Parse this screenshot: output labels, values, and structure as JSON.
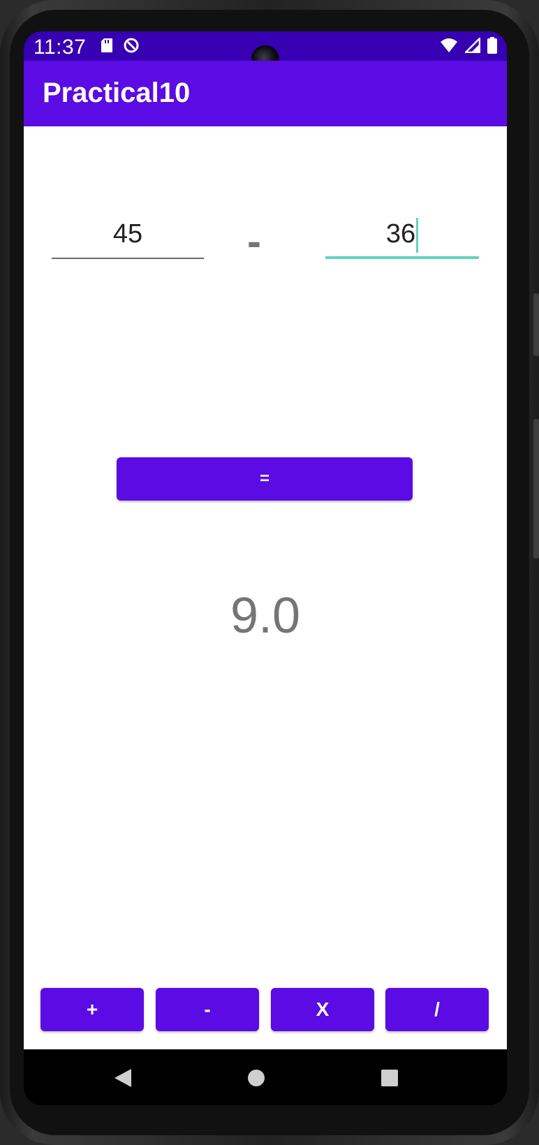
{
  "status_bar": {
    "time": "11:37",
    "left_icons": [
      "sd-card-icon",
      "data-saver-icon"
    ],
    "right_icons": [
      "wifi-icon",
      "signal-icon",
      "battery-icon"
    ],
    "background_color": "#3700B3"
  },
  "app_bar": {
    "title": "Practical10",
    "background_color": "#5B0BE3"
  },
  "inputs": {
    "first_value": "45",
    "second_value": "36",
    "operator_symbol": "-"
  },
  "equals_button": {
    "label": "="
  },
  "result": {
    "value": "9.0"
  },
  "operations": [
    {
      "label": "+"
    },
    {
      "label": "-"
    },
    {
      "label": "X"
    },
    {
      "label": "/"
    }
  ],
  "nav_bar": {
    "icons": [
      "back-icon",
      "home-icon",
      "recents-icon"
    ]
  },
  "colors": {
    "primary": "#5B0BE3",
    "primary_dark": "#3700B3",
    "focus_accent": "#63D3BE",
    "muted_text": "#757575"
  }
}
